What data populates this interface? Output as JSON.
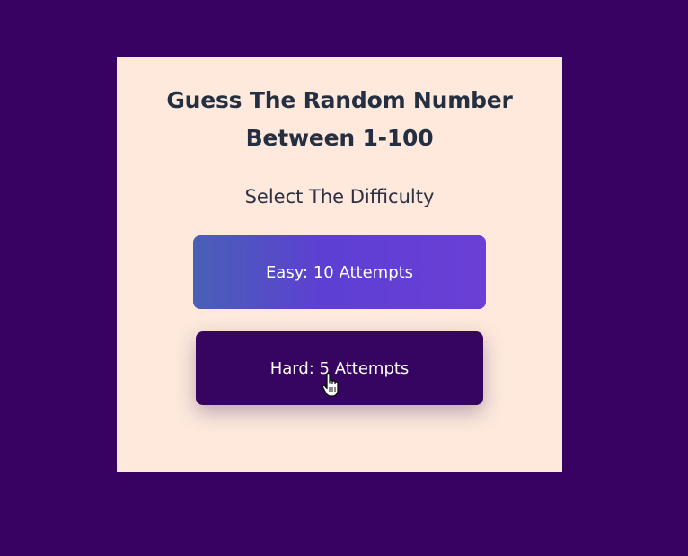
{
  "card": {
    "title_line1": "Guess The Random Number",
    "title_line2": "Between 1-100",
    "subtitle": "Select The Difficulty"
  },
  "buttons": {
    "easy_label": "Easy: 10 Attempts",
    "hard_label": "Hard: 5 Attempts"
  },
  "colors": {
    "background": "#370261",
    "card": "#fee9dc",
    "hard_button": "#360562",
    "easy_gradient_start": "#4960b6",
    "easy_gradient_end": "#6b3fd6"
  },
  "icons": {
    "cursor": "hand-pointer-cursor-icon"
  }
}
